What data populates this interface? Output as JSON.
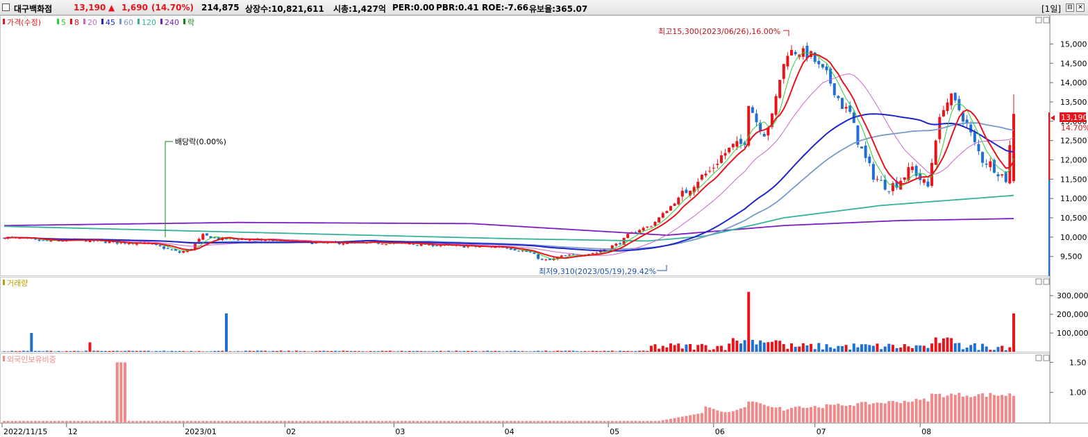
{
  "header": {
    "stock_name": "대구백화점",
    "price": "13,190",
    "change_arrow": "▲",
    "change": "1,690",
    "change_pct": "(14.70%)",
    "volume": "214,875",
    "shares": "상장수:10,821,611",
    "market_cap": "시총:1,427억",
    "per": "PER:0.00",
    "pbr": "PBR:0.41",
    "roe": "ROE:-7.66",
    "retention": "유보율:365.07",
    "period": "[1일]",
    "btn_restore": "⊟",
    "btn_close": "✕"
  },
  "colors": {
    "up": "#e8141b",
    "down": "#1f6fd4",
    "ma5": "#33cc33",
    "ma8": "#e8141b",
    "ma20": "#cc66cc",
    "ma45": "#1f25c8",
    "ma60": "#7799cc",
    "ma120": "#33b399",
    "ma240": "#7a1fc2",
    "volume_label": "#b8a000",
    "foreign": "#f08a8a"
  },
  "chart_data": [
    {
      "type": "candlestick",
      "legend": [
        {
          "label": "가격(수정)",
          "color": "#e8141b"
        },
        {
          "label": "5",
          "color": "#33cc33"
        },
        {
          "label": "8",
          "color": "#e8141b"
        },
        {
          "label": "20",
          "color": "#cc66cc"
        },
        {
          "label": "45",
          "color": "#1f25c8"
        },
        {
          "label": "60",
          "color": "#7799cc"
        },
        {
          "label": "120",
          "color": "#33b399"
        },
        {
          "label": "240",
          "color": "#7a1fc2"
        },
        {
          "label": "락",
          "color": "#118811"
        }
      ],
      "y_ticks": [
        "15,000",
        "14,500",
        "14,000",
        "13,500",
        "13,000",
        "12,500",
        "12,000",
        "11,500",
        "11,000",
        "10,500",
        "10,000",
        "9,500"
      ],
      "ylim": [
        9100,
        15600
      ],
      "x_ticks": [
        "2022/11/15",
        "12",
        "2023/01",
        "02",
        "03",
        "04",
        "05",
        "06",
        "07",
        "08"
      ],
      "current_price_label": "13,190",
      "current_pct_label": "14.70%",
      "annotations": {
        "high": "최고15,300(2023/06/26),16.00%",
        "low": "최저9,310(2023/05/19),29.42%",
        "dividend": "배당락(0.00%)"
      },
      "anchors": [
        [
          0,
          10000
        ],
        [
          10,
          9900
        ],
        [
          20,
          9920
        ],
        [
          30,
          9850
        ],
        [
          35,
          9860
        ],
        [
          40,
          9750
        ],
        [
          45,
          9600
        ],
        [
          48,
          9700
        ],
        [
          51,
          10050
        ],
        [
          55,
          9950
        ],
        [
          60,
          9950
        ],
        [
          70,
          9900
        ],
        [
          80,
          9850
        ],
        [
          90,
          9850
        ],
        [
          100,
          9850
        ],
        [
          110,
          9800
        ],
        [
          120,
          9750
        ],
        [
          128,
          9750
        ],
        [
          135,
          9600
        ],
        [
          138,
          9400
        ],
        [
          140,
          9400
        ],
        [
          143,
          9500
        ],
        [
          148,
          9550
        ],
        [
          152,
          9600
        ],
        [
          154,
          9700
        ],
        [
          158,
          9850
        ],
        [
          160,
          10050
        ],
        [
          163,
          10200
        ],
        [
          166,
          10300
        ],
        [
          169,
          10600
        ],
        [
          172,
          10900
        ],
        [
          175,
          11200
        ],
        [
          178,
          11500
        ],
        [
          181,
          11700
        ],
        [
          184,
          12100
        ],
        [
          187,
          12350
        ],
        [
          189,
          12400
        ],
        [
          190,
          12500
        ],
        [
          191,
          13500
        ],
        [
          193,
          13000
        ],
        [
          195,
          12700
        ],
        [
          197,
          13100
        ],
        [
          199,
          14100
        ],
        [
          201,
          14800
        ],
        [
          204,
          14800
        ],
        [
          207,
          14700
        ],
        [
          209,
          14400
        ],
        [
          211,
          14200
        ],
        [
          213,
          13800
        ],
        [
          215,
          13400
        ],
        [
          217,
          13200
        ],
        [
          219,
          12500
        ],
        [
          221,
          12000
        ],
        [
          223,
          11600
        ],
        [
          225,
          11400
        ],
        [
          227,
          11300
        ],
        [
          229,
          11400
        ],
        [
          231,
          11600
        ],
        [
          233,
          11800
        ],
        [
          235,
          11500
        ],
        [
          237,
          11300
        ],
        [
          239,
          12600
        ],
        [
          241,
          13400
        ],
        [
          243,
          13600
        ],
        [
          245,
          13300
        ],
        [
          247,
          12900
        ],
        [
          249,
          12400
        ],
        [
          251,
          12000
        ],
        [
          253,
          11900
        ],
        [
          255,
          11700
        ],
        [
          257,
          11500
        ],
        [
          259,
          13190
        ]
      ],
      "ma_levels": {
        "ma240": [
          [
            0,
            10300
          ],
          [
            60,
            10380
          ],
          [
            120,
            10350
          ],
          [
            170,
            10050
          ],
          [
            200,
            10300
          ],
          [
            230,
            10430
          ],
          [
            259,
            10480
          ]
        ],
        "ma120": [
          [
            0,
            10280
          ],
          [
            60,
            10130
          ],
          [
            130,
            9960
          ],
          [
            165,
            9900
          ],
          [
            180,
            10030
          ],
          [
            200,
            10500
          ],
          [
            225,
            10820
          ],
          [
            259,
            11080
          ]
        ]
      },
      "volume": {
        "y_ticks": [
          "300,000",
          "200,000",
          "100,000"
        ],
        "ylim": [
          0,
          360000
        ],
        "spikes": [
          [
            7,
            100000
          ],
          [
            22,
            50000
          ],
          [
            57,
            205000
          ],
          [
            191,
            320000
          ],
          [
            259,
            205000
          ]
        ]
      },
      "foreign_ratio": {
        "y_ticks": [
          "1.50",
          "1.00"
        ],
        "ylim": [
          0.5,
          1.62
        ],
        "spike_range": [
          29,
          31
        ],
        "spike_value": 1.5
      }
    }
  ],
  "panels": {
    "volume_title": "거래량",
    "foreign_title": "외국인보유비중"
  }
}
